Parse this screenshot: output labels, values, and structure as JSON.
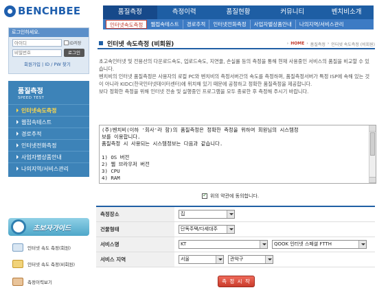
{
  "logo": {
    "text": "BENCHBEE"
  },
  "topnav": {
    "items": [
      "품질측정",
      "측정이력",
      "품질현황",
      "커뮤니티",
      "벤치비소개"
    ],
    "active": 0
  },
  "subnav": {
    "items": [
      "인터넷속도측정",
      "웹접속테스트",
      "경로추적",
      "인터넷전화측정",
      "사업자별상품안내",
      "나의지역/서비스관리"
    ],
    "active": 0
  },
  "login": {
    "title": "로그인하세요.",
    "id_placeholder": "아이디",
    "pw_placeholder": "비밀번호",
    "save_id_label": "ID저장",
    "login_button": "로그인",
    "join_link": "회원가입",
    "find_link": "ID / PW 찾기"
  },
  "speednav": {
    "title": "품질측정",
    "subtitle": "SPEED TEST",
    "items": [
      "인터넷속도측정",
      "웹접속테스트",
      "경로추적",
      "인터넷전화측정",
      "사업자별상품안내",
      "나의지역/서비스관리"
    ],
    "active": 0
  },
  "beginner_guide": "초보자가이드",
  "quicklinks": [
    "인터넷 속도 측정(회원)",
    "인터넷 속도 측정(비회원)",
    "측정이력보기"
  ],
  "page": {
    "title": "인터넷 속도측정 (비회원)",
    "breadcrumb": [
      "HOME",
      "품질측정",
      "인터넷 속도측정 (비회원)"
    ]
  },
  "intro": "초고속인터넷 및 전용선의 다운로드속도, 업로드속도, 지연율, 손실률 등의 측정을 통해 현재 사용중인 서비스의 품질을 비교할 수 있습니다.\n벤치비의 인터넷 품질측정은 사용자의 로컬 PC와 벤치비의 측정서버간의 속도를 측정하며, 품질측정서버가 특정 ISP에 속해 있는 것이 아니라 KIDC(한국인터넷데이터센터)에 위치해 있기 때문에 공정하고 정확한 품질측정을 제공합니다.\n보다 정확한 측정을 위해 인터넷 전송 및 실행중인 프로그램을 모두 종료한 후 측정해 주시기 바랍니다.",
  "terms": "(주)벤치비(이하 '회사'라 함)의 품질측정은 정확한 측정을 위하여 회원님의 시스템정\n보를 이용합니다.\n품질측정 시 사용되는 시스템정보는 다음과 같습니다.\n\n1) OS 버전\n2) 웹 브라우저 버전\n3) CPU\n4) RAM",
  "agree_label": "위의 약관에 동의합니다.",
  "form": {
    "place": {
      "label": "측정장소",
      "value": "집"
    },
    "building": {
      "label": "건물형태",
      "value": "단독주택/다세대주"
    },
    "service": {
      "label": "서비스명",
      "isp": "KT",
      "product": "QOOK 인터넷 스페셜 FTTH"
    },
    "region": {
      "label": "서비스 지역",
      "city": "서울",
      "district": "관악구"
    }
  },
  "start_button": "측 정 시 작"
}
